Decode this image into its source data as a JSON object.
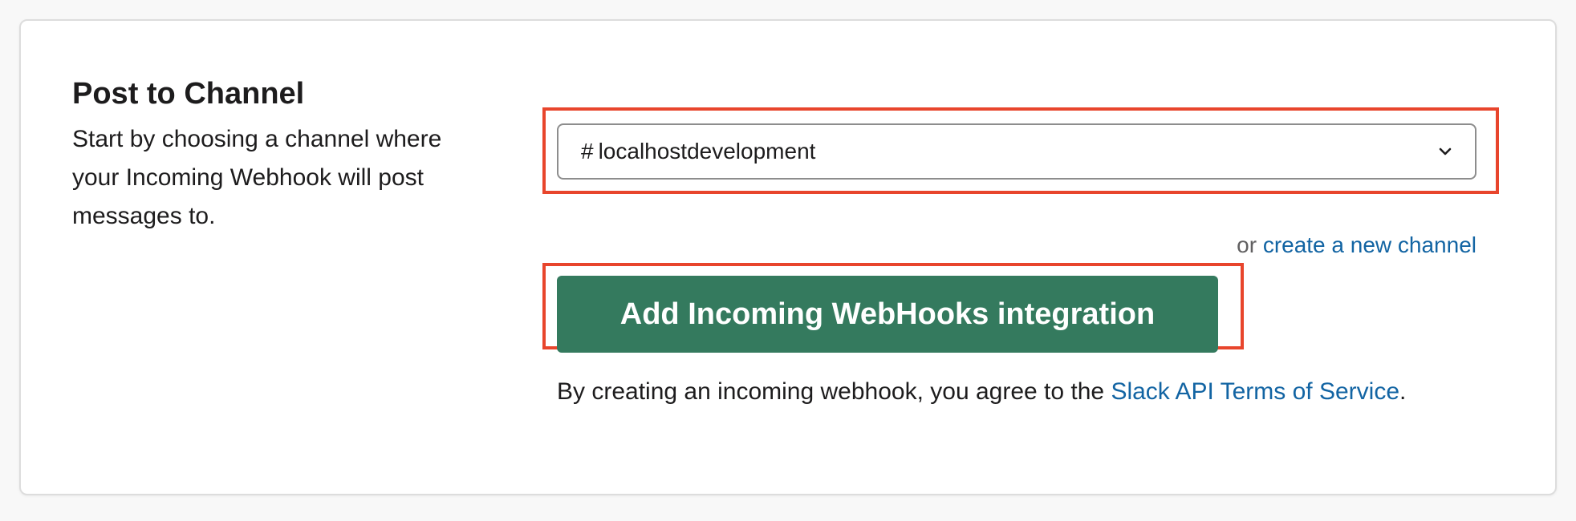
{
  "section": {
    "title": "Post to Channel",
    "description": "Start by choosing a channel where your Incoming Webhook will post messages to."
  },
  "channel_select": {
    "hash": "#",
    "selected": "localhostdevelopment",
    "icon": "chevron-down-icon"
  },
  "create_channel": {
    "prefix": "or",
    "link": "create a new channel"
  },
  "add_button": {
    "label": "Add Incoming WebHooks integration"
  },
  "terms": {
    "prefix": "By creating an incoming webhook, you agree to the",
    "link": "Slack API Terms of Service",
    "suffix": "."
  },
  "colors": {
    "button": "#347a5e",
    "link": "#1264a3",
    "highlight": "#e8452c"
  }
}
